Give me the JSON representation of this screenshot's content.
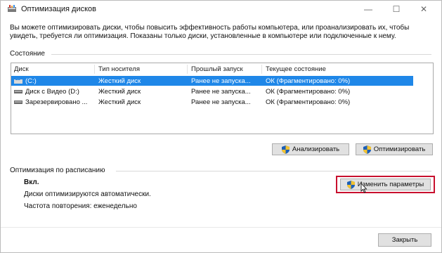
{
  "window": {
    "title": "Оптимизация дисков",
    "icon": "disk-optimize-icon",
    "controls": {
      "minimize": "—",
      "maximize": "☐",
      "close": "✕"
    }
  },
  "description": "Вы можете оптимизировать диски, чтобы повысить эффективность работы компьютера, или проанализировать их, чтобы увидеть, требуется ли оптимизация. Показаны только диски, установленные в компьютере или подключенные к нему.",
  "status": {
    "section_label": "Состояние",
    "columns": [
      "Диск",
      "Тип носителя",
      "Прошлый запуск",
      "Текущее состояние"
    ],
    "rows": [
      {
        "disk": "(C:)",
        "media": "Жесткий диск",
        "last_run": "Ранее не запуска...",
        "state": "ОК (Фрагментировано: 0%)",
        "selected": true,
        "icon": "windows-drive-icon"
      },
      {
        "disk": "Диск с Видео (D:)",
        "media": "Жесткий диск",
        "last_run": "Ранее не запуска...",
        "state": "ОК (Фрагментировано: 0%)",
        "selected": false,
        "icon": "hard-drive-icon"
      },
      {
        "disk": "Зарезервировано ...",
        "media": "Жесткий диск",
        "last_run": "Ранее не запуска...",
        "state": "ОК (Фрагментировано: 0%)",
        "selected": false,
        "icon": "hard-drive-icon"
      }
    ],
    "analyze_label": "Анализировать",
    "optimize_label": "Оптимизировать"
  },
  "schedule": {
    "section_label": "Оптимизация по расписанию",
    "state": "Вкл.",
    "auto_text": "Диски оптимизируются автоматически.",
    "frequency": "Частота повторения: еженедельно",
    "change_label": "Изменить параметры"
  },
  "footer": {
    "close_label": "Закрыть"
  },
  "colors": {
    "selection": "#1f87e8",
    "highlight": "#c8102e",
    "button": "#e1e1e1"
  }
}
